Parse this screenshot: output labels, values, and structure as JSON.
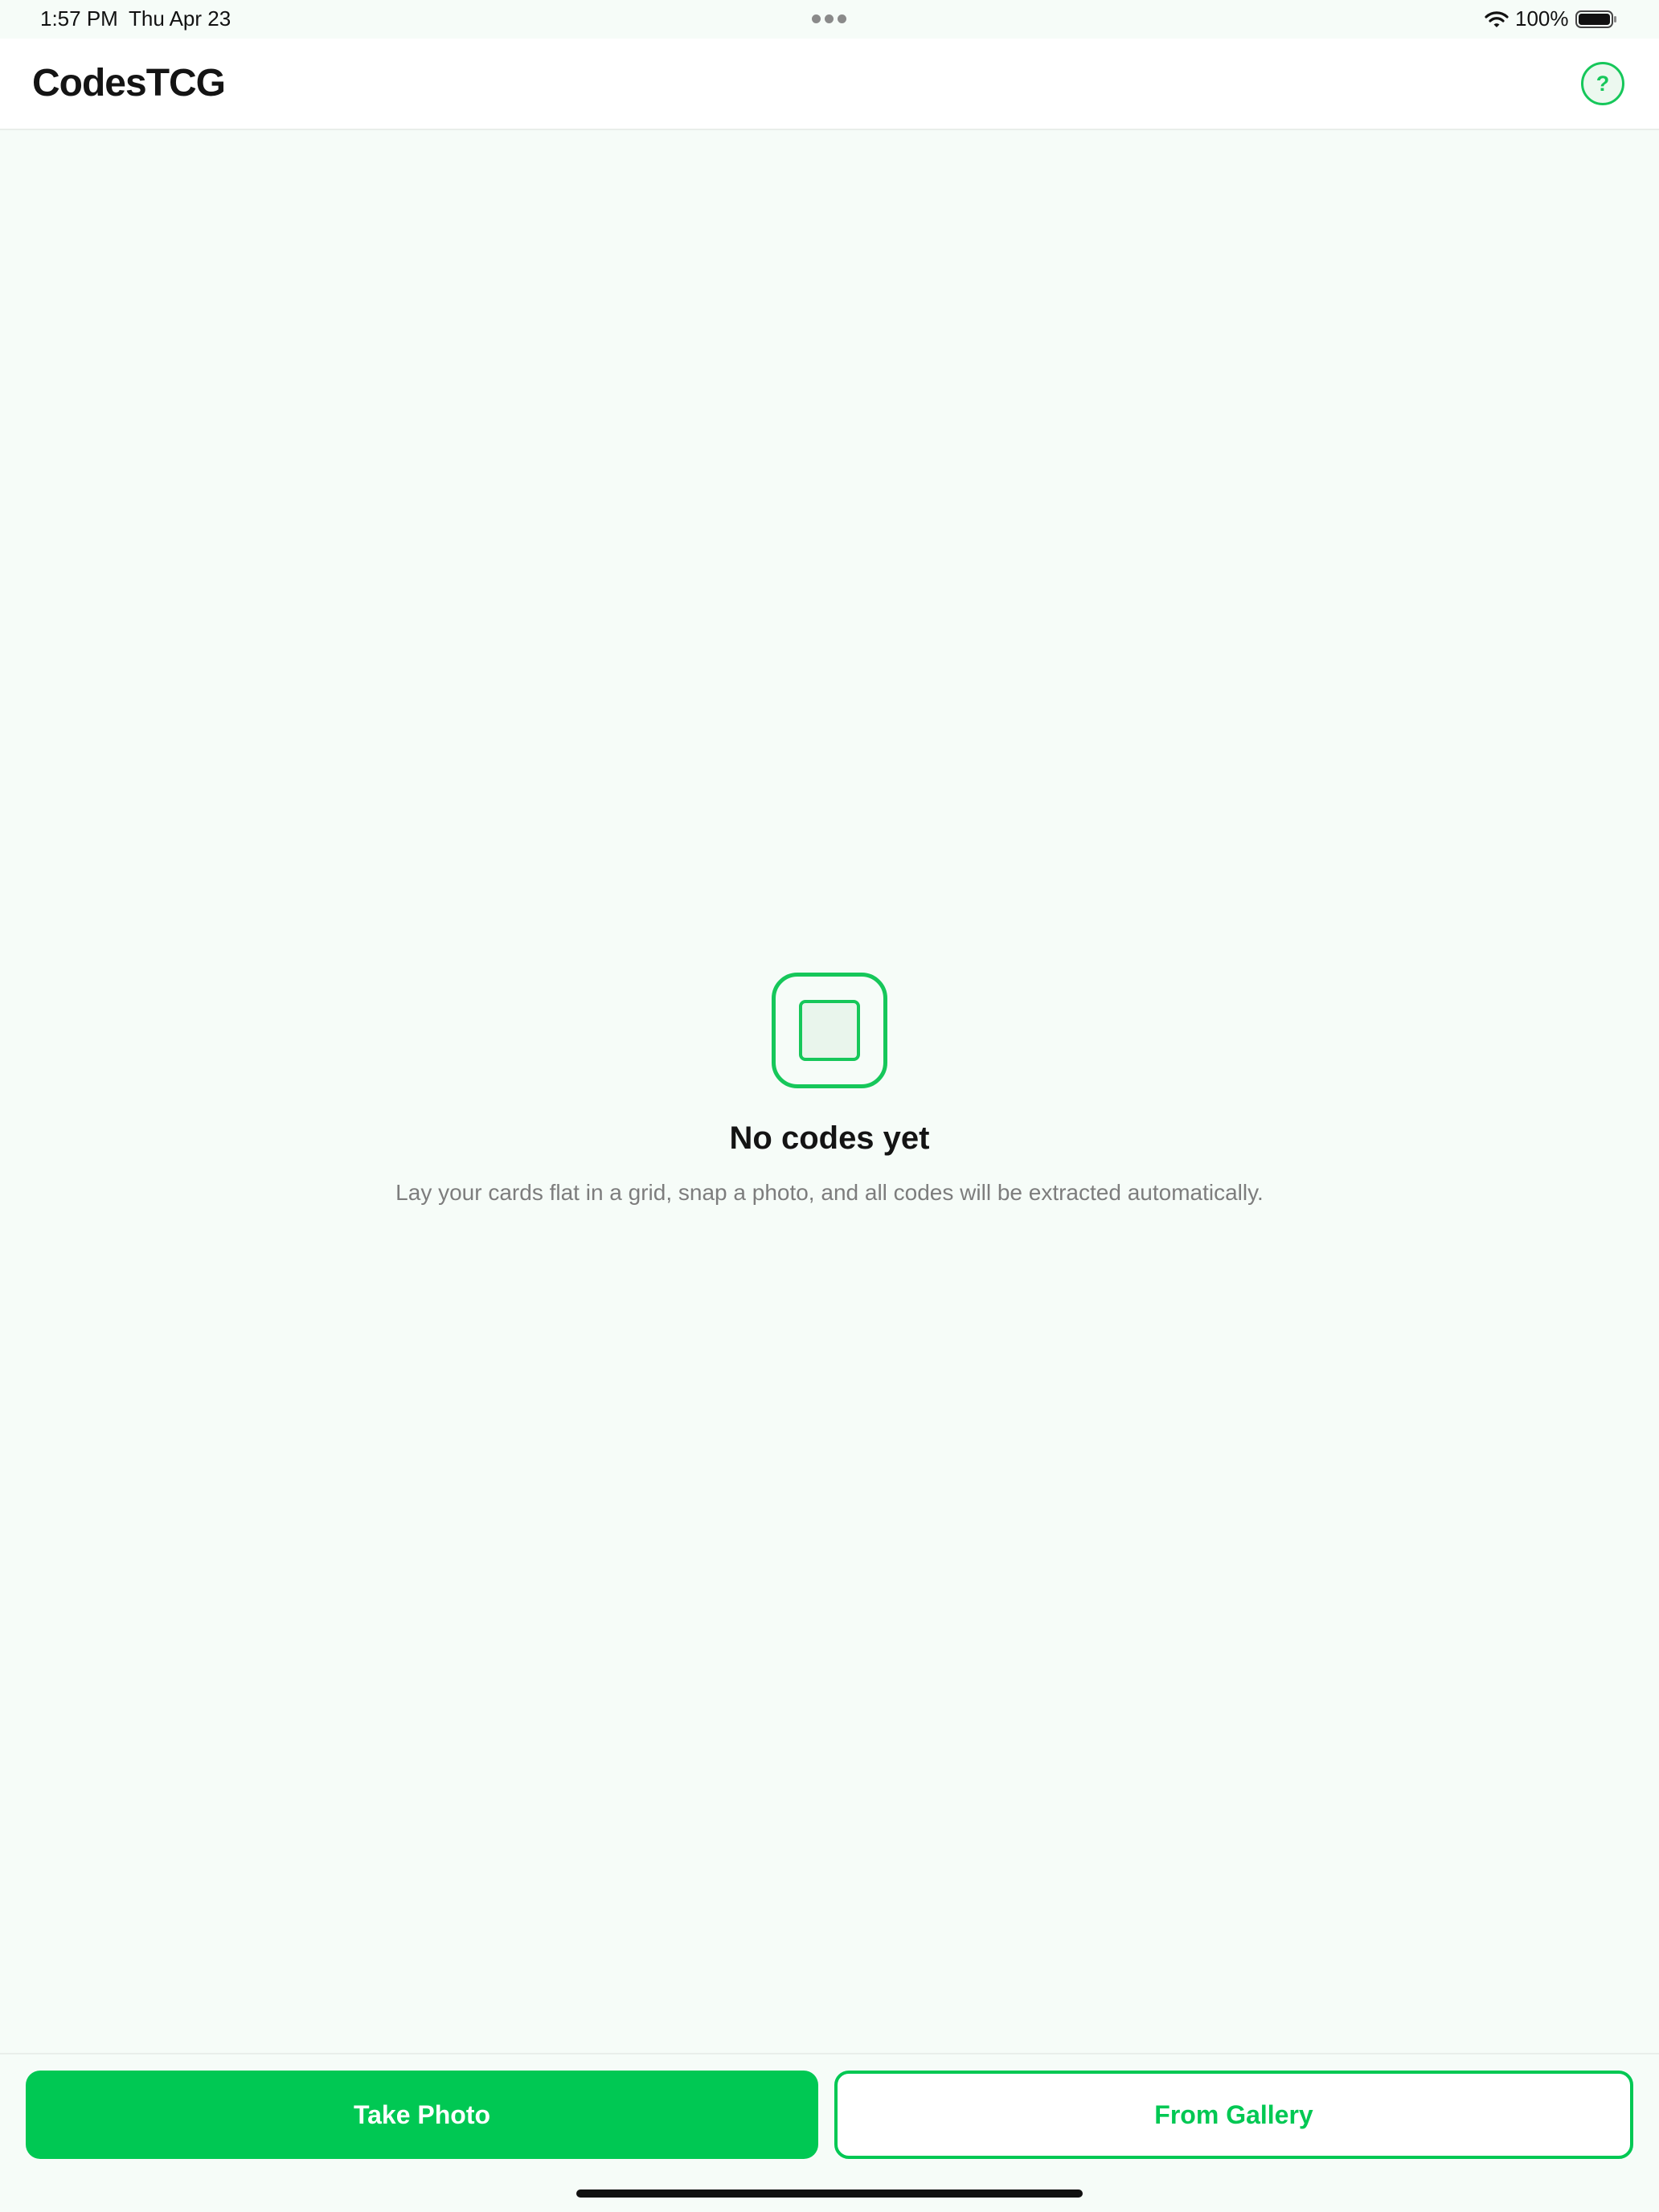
{
  "status_bar": {
    "time": "1:57 PM",
    "date": "Thu Apr 23",
    "battery": "100%",
    "icons": [
      "wifi-icon",
      "battery-icon",
      "multitasking-dots-icon"
    ]
  },
  "header": {
    "title": "CodesTCG",
    "help_label": "?",
    "help_icon": "help-circle-icon"
  },
  "empty_state": {
    "icon": "card-frame-icon",
    "title": "No codes yet",
    "description": "Lay your cards flat in a grid, snap a photo, and all codes will be extracted automatically."
  },
  "actions": {
    "take_photo": "Take Photo",
    "from_gallery": "From Gallery"
  },
  "colors": {
    "accent": "#00c853",
    "background": "#f6fcf8",
    "text_primary": "#141414",
    "text_secondary": "#7d7d7d"
  }
}
